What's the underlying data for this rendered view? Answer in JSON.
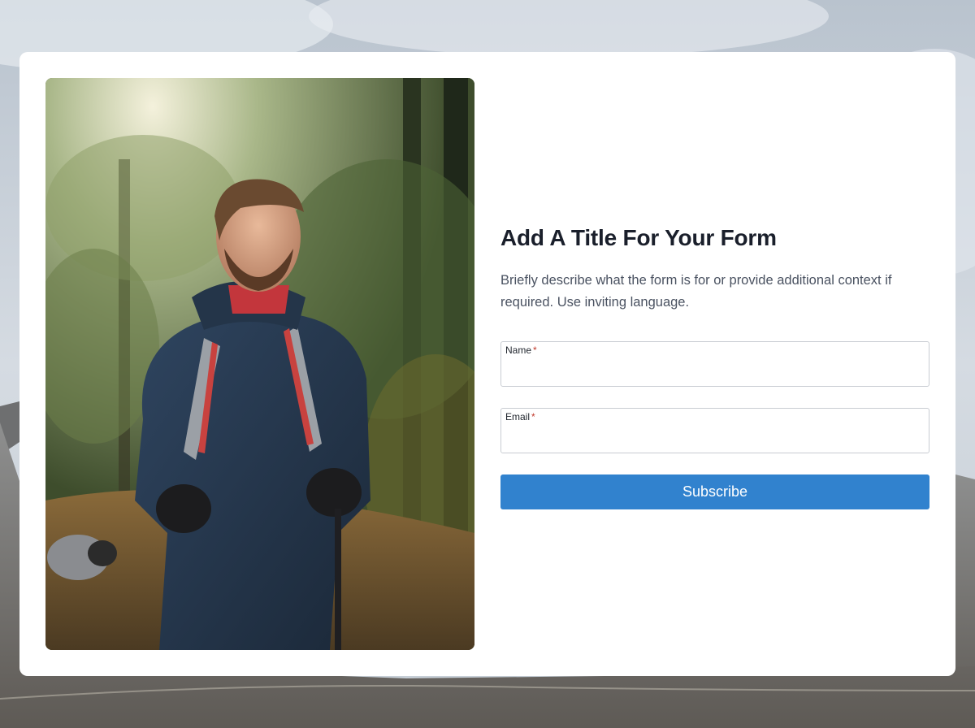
{
  "form": {
    "title": "Add A Title For Your Form",
    "description": "Briefly describe what the form is for or provide additional context if required. Use inviting language.",
    "fields": [
      {
        "label": "Name",
        "required_mark": "*",
        "value": "",
        "placeholder": ""
      },
      {
        "label": "Email",
        "required_mark": "*",
        "value": "",
        "placeholder": ""
      }
    ],
    "submit_label": "Subscribe"
  },
  "colors": {
    "accent": "#3182ce",
    "title": "#1a1f2b",
    "description": "#4a5261",
    "required": "#c0392b",
    "card": "#ffffff"
  },
  "images": {
    "background": "mountain-landscape-background",
    "photo": "hiker-in-forest-photo"
  }
}
